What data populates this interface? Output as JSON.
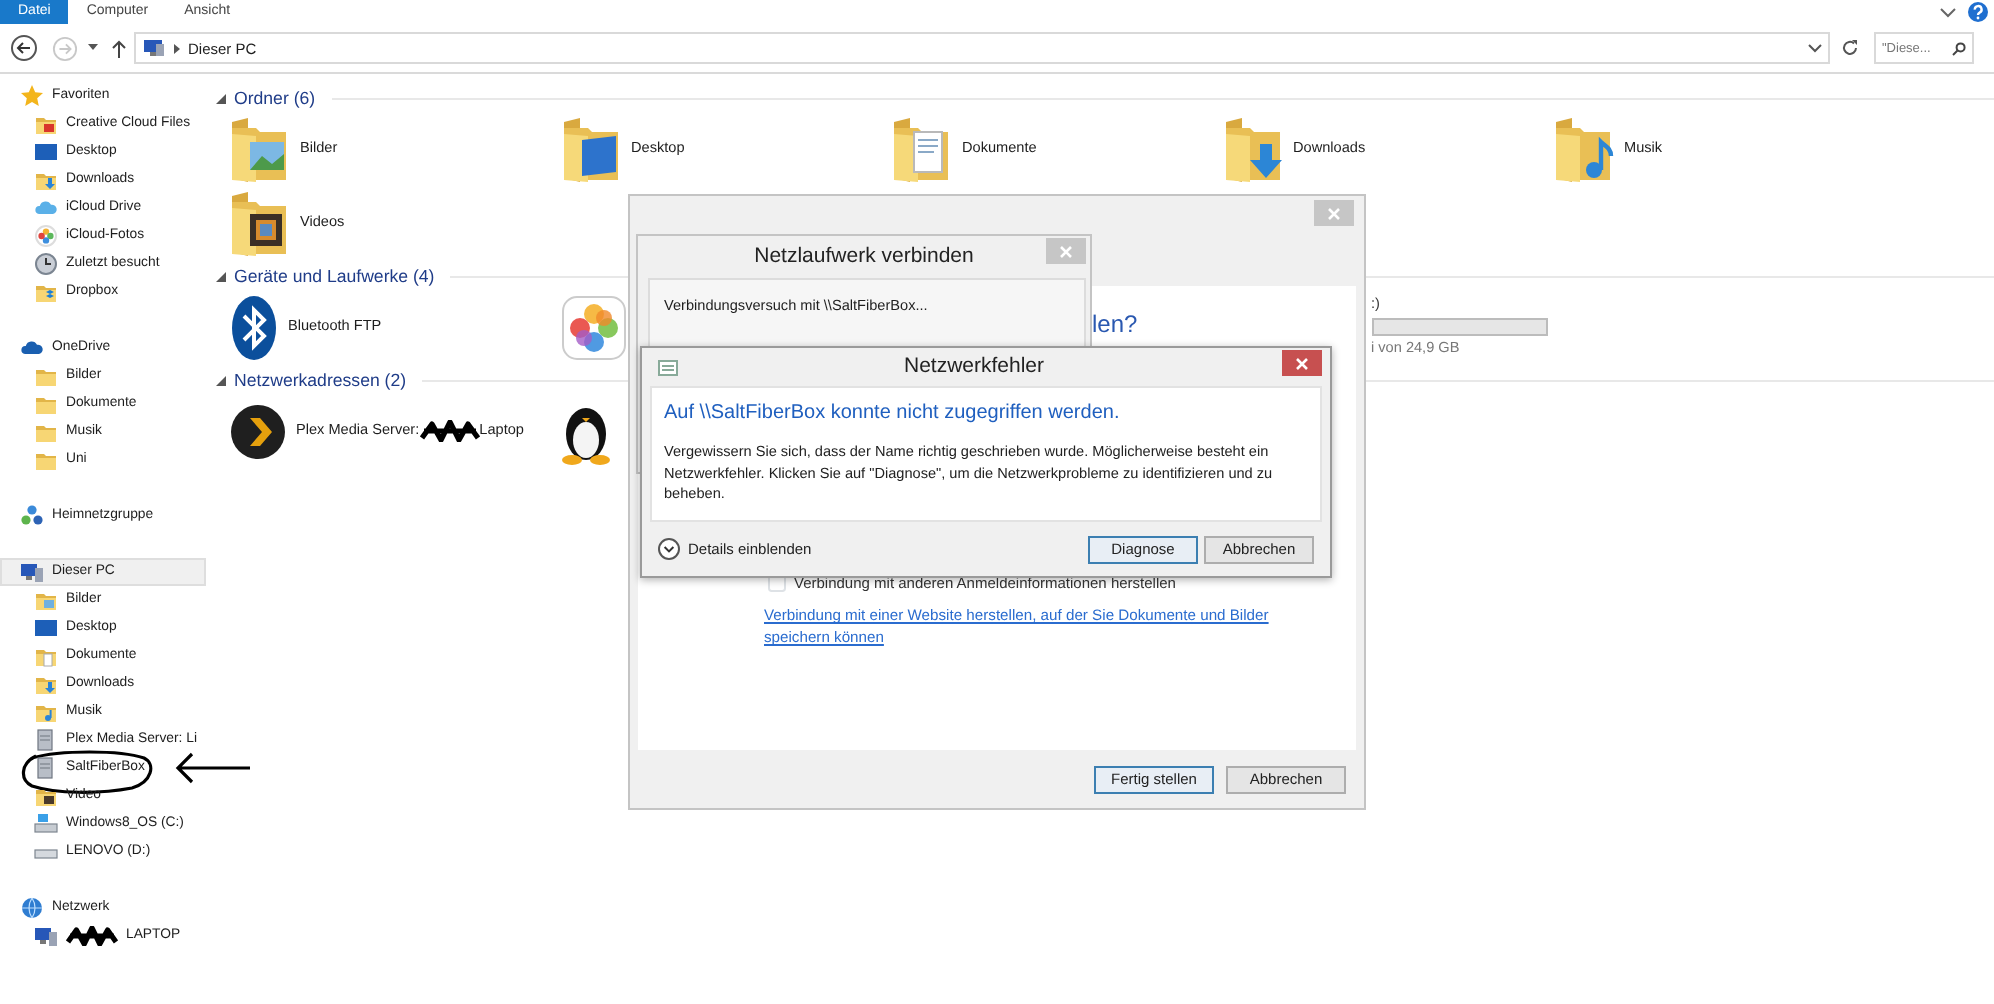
{
  "ribbon": {
    "tabs": [
      {
        "label": "Datei",
        "selected": true
      },
      {
        "label": "Computer",
        "selected": false
      },
      {
        "label": "Ansicht",
        "selected": false
      }
    ]
  },
  "toolbar": {
    "path": "Dieser PC",
    "search": {
      "placeholder": "\"Diese..."
    }
  },
  "sidebar": {
    "groups": [
      {
        "label": "Favoriten",
        "kind": "star",
        "selected": false,
        "children": [
          {
            "label": "Creative Cloud Files",
            "kind": "creative-cloud",
            "selected": false
          },
          {
            "label": "Desktop",
            "kind": "desktop",
            "selected": false
          },
          {
            "label": "Downloads",
            "kind": "downloads",
            "selected": false
          },
          {
            "label": "iCloud Drive",
            "kind": "cloud",
            "selected": false
          },
          {
            "label": "iCloud-Fotos",
            "kind": "photos",
            "selected": false
          },
          {
            "label": "Zuletzt besucht",
            "kind": "recent",
            "selected": false
          },
          {
            "label": "Dropbox",
            "kind": "dropbox",
            "selected": false
          }
        ]
      },
      {
        "label": "OneDrive",
        "kind": "onedrive",
        "selected": false,
        "children": [
          {
            "label": "Bilder",
            "kind": "folder",
            "selected": false
          },
          {
            "label": "Dokumente",
            "kind": "folder",
            "selected": false
          },
          {
            "label": "Musik",
            "kind": "folder",
            "selected": false
          },
          {
            "label": "Uni",
            "kind": "folder",
            "selected": false
          }
        ]
      },
      {
        "label": "Heimnetzgruppe",
        "kind": "homegroup",
        "selected": false
      },
      {
        "label": "Dieser PC",
        "kind": "pc",
        "selected": true,
        "children": [
          {
            "label": "Bilder",
            "kind": "pictures",
            "selected": false
          },
          {
            "label": "Desktop",
            "kind": "desktop",
            "selected": false
          },
          {
            "label": "Dokumente",
            "kind": "documents",
            "selected": false
          },
          {
            "label": "Downloads",
            "kind": "downloads",
            "selected": false
          },
          {
            "label": "Musik",
            "kind": "music",
            "selected": false
          },
          {
            "label": "Plex Media Server: Li",
            "kind": "server",
            "selected": false
          },
          {
            "label": "SaltFiberBox",
            "kind": "server",
            "selected": false,
            "circled": true
          },
          {
            "label": "Video",
            "kind": "videos",
            "selected": false
          },
          {
            "label": "Windows8_OS (C:)",
            "kind": "system-drive",
            "selected": false
          },
          {
            "label": "LENOVO (D:)",
            "kind": "drive",
            "selected": false
          }
        ]
      },
      {
        "label": "Netzwerk",
        "kind": "network",
        "selected": false,
        "children": [
          {
            "label": "LAPTOP",
            "kind": "pc",
            "selected": false,
            "redacted": true
          }
        ]
      }
    ]
  },
  "sections": [
    {
      "title": "Ordner (6)",
      "expanded": true,
      "items": [
        {
          "label": "Bilder",
          "kind": "pictures"
        },
        {
          "label": "Desktop",
          "kind": "desktop"
        },
        {
          "label": "Dokumente",
          "kind": "documents"
        },
        {
          "label": "Downloads",
          "kind": "downloads"
        },
        {
          "label": "Musik",
          "kind": "music"
        },
        {
          "label": "Videos",
          "kind": "videos"
        }
      ]
    },
    {
      "title": "Geräte und Laufwerke (4)",
      "expanded": true,
      "items": [
        {
          "label": "Bluetooth FTP",
          "kind": "bluetooth"
        },
        {
          "kind": "photos"
        },
        {
          "label": ":)",
          "kind": "drive",
          "detail": "i von 24,9 GB"
        }
      ]
    },
    {
      "title": "Netzwerkadressen (2)",
      "expanded": true,
      "items": [
        {
          "label": "Plex Media Server:",
          "label_after": "Laptop",
          "kind": "plex",
          "redacted": true
        },
        {
          "kind": "linux"
        }
      ]
    }
  ],
  "wizard_dialog": {
    "heading": "len?",
    "checkbox": {
      "label": "Verbindung mit anderen Anmeldeinformationen herstellen",
      "checked": false
    },
    "link": "Verbindung mit einer Website herstellen, auf der Sie Dokumente und Bilder speichern können",
    "buttons": [
      {
        "label": "Fertig stellen",
        "default": true
      },
      {
        "label": "Abbrechen",
        "default": false
      }
    ]
  },
  "progress_dialog": {
    "title": "Netzlaufwerk verbinden",
    "message": "Verbindungsversuch mit \\\\SaltFiberBox..."
  },
  "error_dialog": {
    "title": "Netzwerkfehler",
    "heading": "Auf \\\\SaltFiberBox konnte nicht zugegriffen werden.",
    "message": "Vergewissern Sie sich, dass der Name richtig geschrieben wurde. Möglicherweise besteht ein Netzwerkfehler. Klicken Sie auf \"Diagnose\", um die Netzwerkprobleme zu identifizieren und zu beheben.",
    "details": "Details einblenden",
    "buttons": [
      {
        "label": "Diagnose",
        "default": true
      },
      {
        "label": "Abbrechen",
        "default": false
      }
    ]
  }
}
